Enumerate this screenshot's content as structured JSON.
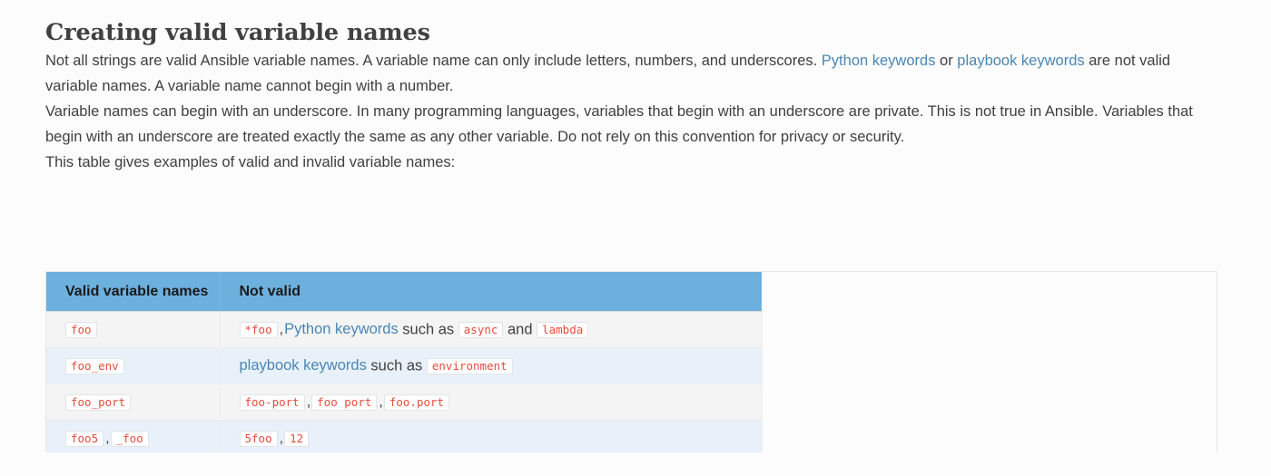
{
  "page": {
    "title": "Creating valid variable names",
    "background_color": "#fcfcfc",
    "text_color": "#404040",
    "link_color": "#4b86b4"
  },
  "paragraphs": {
    "p1_a": "Not all strings are valid Ansible variable names. A variable name can only include letters, numbers, and underscores. ",
    "p1_link1": "Python keywords",
    "p1_b": " or ",
    "p1_link2": "playbook keywords",
    "p1_c": " are not valid variable names. A variable name cannot begin with a number.",
    "p2": "Variable names can begin with an underscore. In many programming languages, variables that begin with an underscore are private. This is not true in Ansible. Variables that begin with an underscore are treated exactly the same as any other variable. Do not rely on this convention for privacy or security.",
    "p3": "This table gives examples of valid and invalid variable names:"
  },
  "table": {
    "header_bg": "#6cb0de",
    "columns": [
      "Valid variable names",
      "Not valid"
    ],
    "rows": [
      {
        "valid": [
          "foo"
        ],
        "invalid_parts": [
          {
            "type": "code",
            "text": "*foo"
          },
          {
            "type": "sep",
            "text": ","
          },
          {
            "type": "link",
            "text": "Python keywords"
          },
          {
            "type": "text",
            "text": " such as "
          },
          {
            "type": "code",
            "text": "async"
          },
          {
            "type": "text",
            "text": " and "
          },
          {
            "type": "code",
            "text": "lambda"
          }
        ]
      },
      {
        "valid": [
          "foo_env"
        ],
        "invalid_parts": [
          {
            "type": "link",
            "text": "playbook keywords"
          },
          {
            "type": "text",
            "text": " such as "
          },
          {
            "type": "code",
            "text": "environment"
          }
        ]
      },
      {
        "valid": [
          "foo_port"
        ],
        "invalid_parts": [
          {
            "type": "code",
            "text": "foo-port"
          },
          {
            "type": "sep",
            "text": ","
          },
          {
            "type": "code",
            "text": "foo port"
          },
          {
            "type": "sep",
            "text": ","
          },
          {
            "type": "code",
            "text": "foo.port"
          }
        ]
      },
      {
        "valid": [
          "foo5",
          "_foo"
        ],
        "invalid_parts": [
          {
            "type": "code",
            "text": "5foo"
          },
          {
            "type": "sep",
            "text": ","
          },
          {
            "type": "code",
            "text": "12"
          }
        ]
      }
    ]
  }
}
